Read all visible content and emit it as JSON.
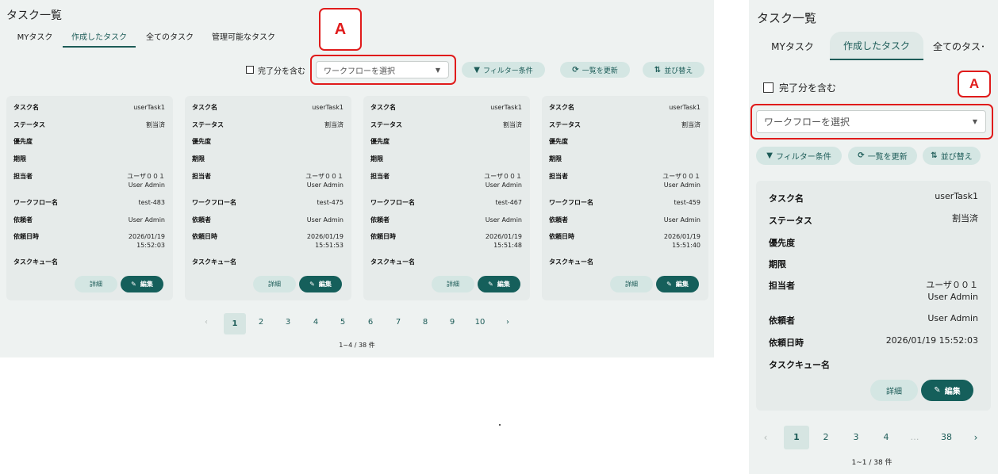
{
  "page_title": "タスク一覧",
  "tabs": [
    "MYタスク",
    "作成したタスク",
    "全てのタスク",
    "管理可能なタスク"
  ],
  "mobile_tabs": [
    "MYタスク",
    "作成したタスク",
    "全てのタス･"
  ],
  "include_completed_label": "完了分を含む",
  "workflow_select_placeholder": "ワークフローを選択",
  "filter_label": "フィルター条件",
  "refresh_label": "一覧を更新",
  "sort_label": "並び替え",
  "marker_label": "A",
  "field_labels": {
    "task_name": "タスク名",
    "status": "ステータス",
    "priority": "優先度",
    "deadline": "期限",
    "assignee": "担当者",
    "workflow_name": "ワークフロー名",
    "requester": "依頼者",
    "requested_at": "依頼日時",
    "task_queue": "タスクキュー名"
  },
  "cards": [
    {
      "task_name": "userTask1",
      "status": "割当済",
      "assignee_1": "ユーザ００１",
      "assignee_2": "User Admin",
      "workflow_name": "test-483",
      "requester": "User Admin",
      "date": "2026/01/19",
      "time": "15:52:03"
    },
    {
      "task_name": "userTask1",
      "status": "割当済",
      "assignee_1": "ユーザ００１",
      "assignee_2": "User Admin",
      "workflow_name": "test-475",
      "requester": "User Admin",
      "date": "2026/01/19",
      "time": "15:51:53"
    },
    {
      "task_name": "userTask1",
      "status": "割当済",
      "assignee_1": "ユーザ００１",
      "assignee_2": "User Admin",
      "workflow_name": "test-467",
      "requester": "User Admin",
      "date": "2026/01/19",
      "time": "15:51:48"
    },
    {
      "task_name": "userTask1",
      "status": "割当済",
      "assignee_1": "ユーザ００１",
      "assignee_2": "User Admin",
      "workflow_name": "test-459",
      "requester": "User Admin",
      "date": "2026/01/19",
      "time": "15:51:40"
    }
  ],
  "mobile_card": {
    "task_name": "userTask1",
    "status": "割当済",
    "assignee_1": "ユーザ００１",
    "assignee_2": "User Admin",
    "requester": "User Admin",
    "requested_at": "2026/01/19 15:52:03"
  },
  "detail_label": "詳細",
  "edit_label": "編集",
  "pagination": {
    "prev": "‹",
    "next": "›",
    "pages": [
      "1",
      "2",
      "3",
      "4",
      "5",
      "6",
      "7",
      "8",
      "9",
      "10"
    ],
    "current": "1",
    "info": "1~4 / 38 件"
  },
  "mobile_pagination": {
    "pages": [
      "1",
      "2",
      "3",
      "4"
    ],
    "ellipsis": "…",
    "last": "38",
    "info": "1~1 / 38 件"
  },
  "colors": {
    "accent": "#155f5b",
    "highlight": "#e01b1b",
    "background": "#eef2f1"
  },
  "icons": {
    "filter": "filter-icon",
    "refresh": "refresh-icon",
    "sort": "sort-icon",
    "edit": "pencil-icon",
    "dropdown": "chevron-down-icon"
  }
}
